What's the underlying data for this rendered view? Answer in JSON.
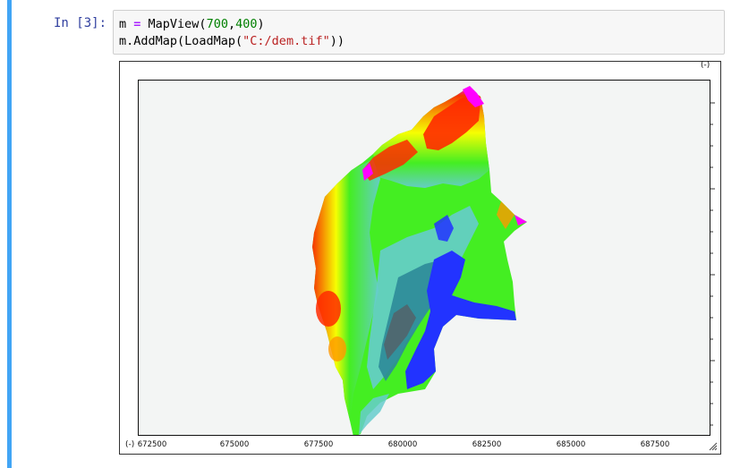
{
  "cell": {
    "prompt": "In [3]:",
    "code": {
      "line1": {
        "var": "m ",
        "op": "=",
        "fn": " MapView(",
        "arg1": "700",
        "comma": ",",
        "arg2": "400",
        "close": ")"
      },
      "line2": {
        "pre": "m.AddMap(LoadMap(",
        "str": "\"C:/dem.tif\"",
        "post": "))"
      }
    }
  },
  "map": {
    "corner_top_label": "(-)",
    "corner_left_label": "(-)",
    "x_ticks": [
      "672500",
      "675000",
      "677500",
      "680000",
      "682500",
      "685000",
      "687500"
    ],
    "colors": {
      "magenta": "#ff00ff",
      "red": "#ff2a00",
      "orange": "#ff9900",
      "yellow": "#ffff00",
      "green": "#44ee22",
      "cyan": "#66cccc",
      "teal": "#2e8a99",
      "blue": "#2233ff",
      "gray": "#555f66"
    }
  }
}
